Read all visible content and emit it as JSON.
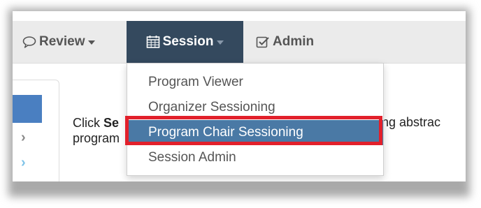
{
  "navbar": {
    "review_label": "Review",
    "session_label": "Session",
    "admin_label": "Admin"
  },
  "session_menu": {
    "items": [
      {
        "label": "Program Viewer"
      },
      {
        "label": "Organizer Sessioning"
      },
      {
        "label": "Program Chair Sessioning"
      },
      {
        "label": "Session Admin"
      }
    ]
  },
  "content": {
    "click_text": "Click ",
    "bold_text": "Se",
    "tail_text": "ng abstrac",
    "line2_text": "program"
  },
  "colors": {
    "session_tab_bg": "#34495e",
    "highlight_item_bg": "#4a79a5",
    "annotation_border": "#e2202b",
    "sidebar_active": "#4a7fc1"
  },
  "icons": {
    "review": "speech-bubble-icon",
    "session": "calendar-icon",
    "admin": "checkbox-icon"
  }
}
